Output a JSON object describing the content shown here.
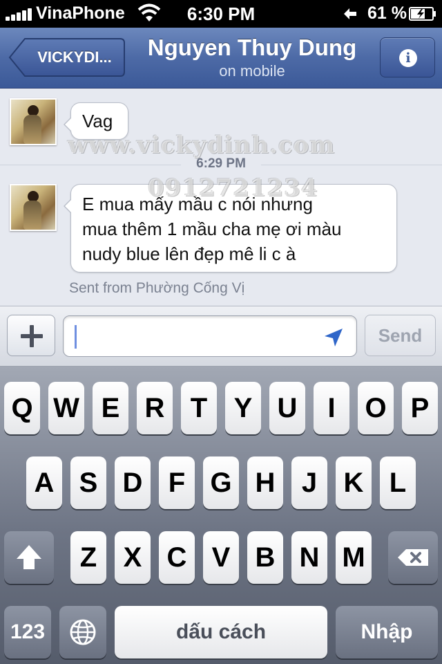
{
  "status_bar": {
    "carrier": "VinaPhone",
    "time": "6:30 PM",
    "battery_percent": "61 %",
    "battery_level": 0.61,
    "signal_bars": 5
  },
  "nav": {
    "back_label": "VICKYDI...",
    "title": "Nguyen Thuy Dung",
    "subtitle": "on mobile",
    "info_icon": "i"
  },
  "messages": [
    {
      "text": "Vag"
    },
    {
      "text_lines": [
        "E mua mấy mầu c nói nhưng",
        "mua thêm 1 mầu cha mẹ ơi màu",
        "nudy blue lên đẹp mê li c à"
      ]
    }
  ],
  "timestamp": "6:29 PM",
  "sent_from": "Sent from Phường Cống Vị",
  "watermark": {
    "site": "www.vickydinh.com",
    "phone": "0912721234"
  },
  "compose": {
    "plus_label": "+",
    "input_value": "",
    "send_label": "Send"
  },
  "keyboard": {
    "row1": [
      "Q",
      "W",
      "E",
      "R",
      "T",
      "Y",
      "U",
      "I",
      "O",
      "P"
    ],
    "row2": [
      "A",
      "S",
      "D",
      "F",
      "G",
      "H",
      "J",
      "K",
      "L"
    ],
    "row3": [
      "Z",
      "X",
      "C",
      "V",
      "B",
      "N",
      "M"
    ],
    "numbers_label": "123",
    "space_label": "dấu cách",
    "return_label": "Nhập"
  }
}
